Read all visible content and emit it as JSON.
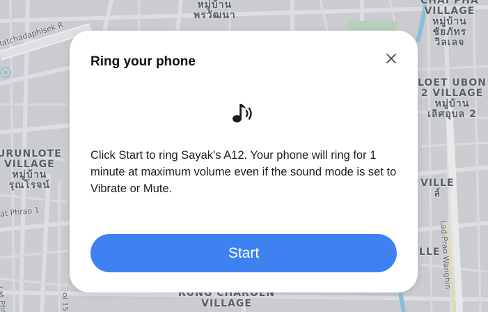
{
  "map": {
    "area_labels": [
      "หมู่บ้าน\nพรวัฒนา",
      "CHAI PHA\nVILLAGE\nหมู่บ้าน\nชัยภัทร\nวิลเลจ",
      "LOET UBON\n2 VILLAGE\nหมู่บ้าน\nเลิศอุบล 2",
      "URUNLOTE\nVILLAGE\nหมู่บ้าน\nรุณโรจน์",
      "VILLE\nล์",
      "LLE",
      "RUNG CHAROEN\nVILLAGE"
    ],
    "road_labels": [
      "Ratchadaphisek R",
      "at Phrao 1",
      "Lat Phrao",
      "oi 15",
      "Lad Prao Wanghin"
    ]
  },
  "dialog": {
    "title": "Ring your phone",
    "close_icon": "close-icon",
    "sound_icon": "music-note-sound-icon",
    "body": "Click Start to ring Sayak's A12. Your phone will ring for 1 minute at maximum volume even if the sound mode is set to Vibrate or Mute.",
    "start_label": "Start",
    "accent_color": "#3e82f1"
  }
}
